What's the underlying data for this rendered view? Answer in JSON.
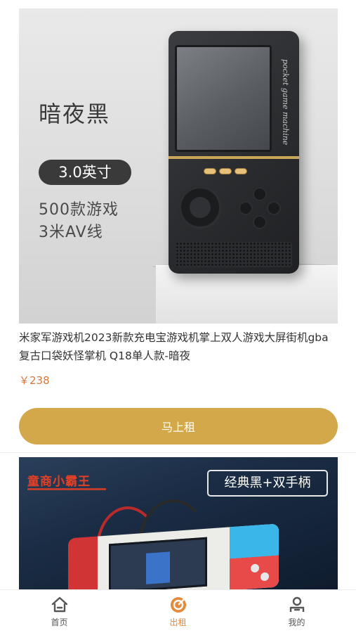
{
  "products": [
    {
      "image_text": {
        "color_name": "暗夜黑",
        "size": "3.0英寸",
        "games": "500款游戏",
        "av_cable": "3米AV线",
        "device_script": "pocket game machine"
      },
      "title": "米家军游戏机2023新款充电宝游戏机掌上双人游戏大屏街机gba复古口袋妖怪掌机 Q18单人款-暗夜",
      "price": "￥238",
      "button_label": "马上租"
    },
    {
      "image_text": {
        "brand": "童商小霸王",
        "tag": "经典黑+双手柄"
      }
    }
  ],
  "tabbar": {
    "items": [
      {
        "label": "首页",
        "icon": "home-icon"
      },
      {
        "label": "出租",
        "icon": "rent-icon",
        "active": true
      },
      {
        "label": "我的",
        "icon": "profile-icon"
      }
    ]
  },
  "colors": {
    "accent": "#d2a84a",
    "price": "#d9783a",
    "active_tab": "#e5893a"
  }
}
